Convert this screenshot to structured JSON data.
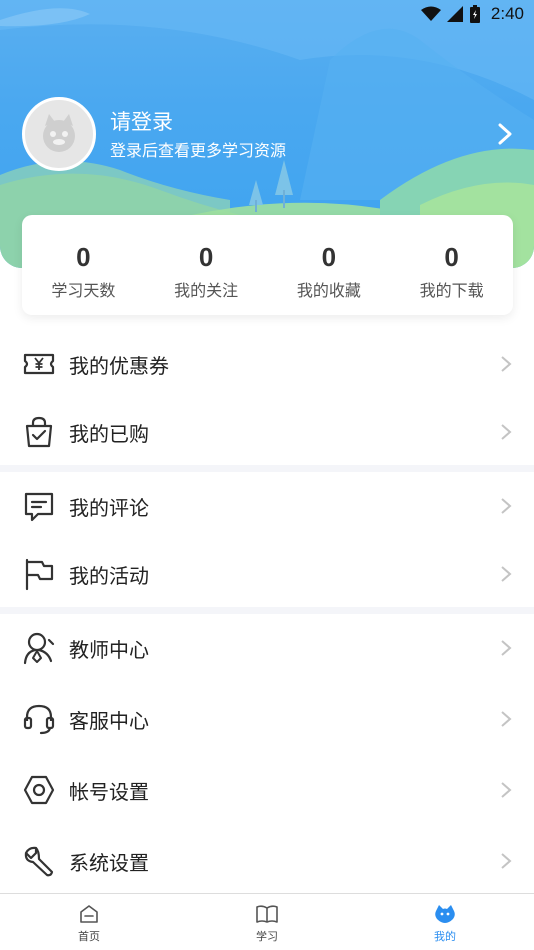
{
  "status": {
    "time": "2:40"
  },
  "profile": {
    "title": "请登录",
    "subtitle": "登录后查看更多学习资源"
  },
  "stats": [
    {
      "value": "0",
      "label": "学习天数"
    },
    {
      "value": "0",
      "label": "我的关注"
    },
    {
      "value": "0",
      "label": "我的收藏"
    },
    {
      "value": "0",
      "label": "我的下载"
    }
  ],
  "menu": {
    "coupons": "我的优惠券",
    "purchased": "我的已购",
    "comments": "我的评论",
    "activities": "我的活动",
    "teacher": "教师中心",
    "service": "客服中心",
    "account": "帐号设置",
    "system": "系统设置"
  },
  "tabs": [
    {
      "label": "首页",
      "icon": "home-icon"
    },
    {
      "label": "学习",
      "icon": "book-icon"
    },
    {
      "label": "我的",
      "icon": "profile-icon",
      "active": true
    }
  ],
  "colors": {
    "accent": "#2b8ef0",
    "header": "#4aa8f0"
  }
}
